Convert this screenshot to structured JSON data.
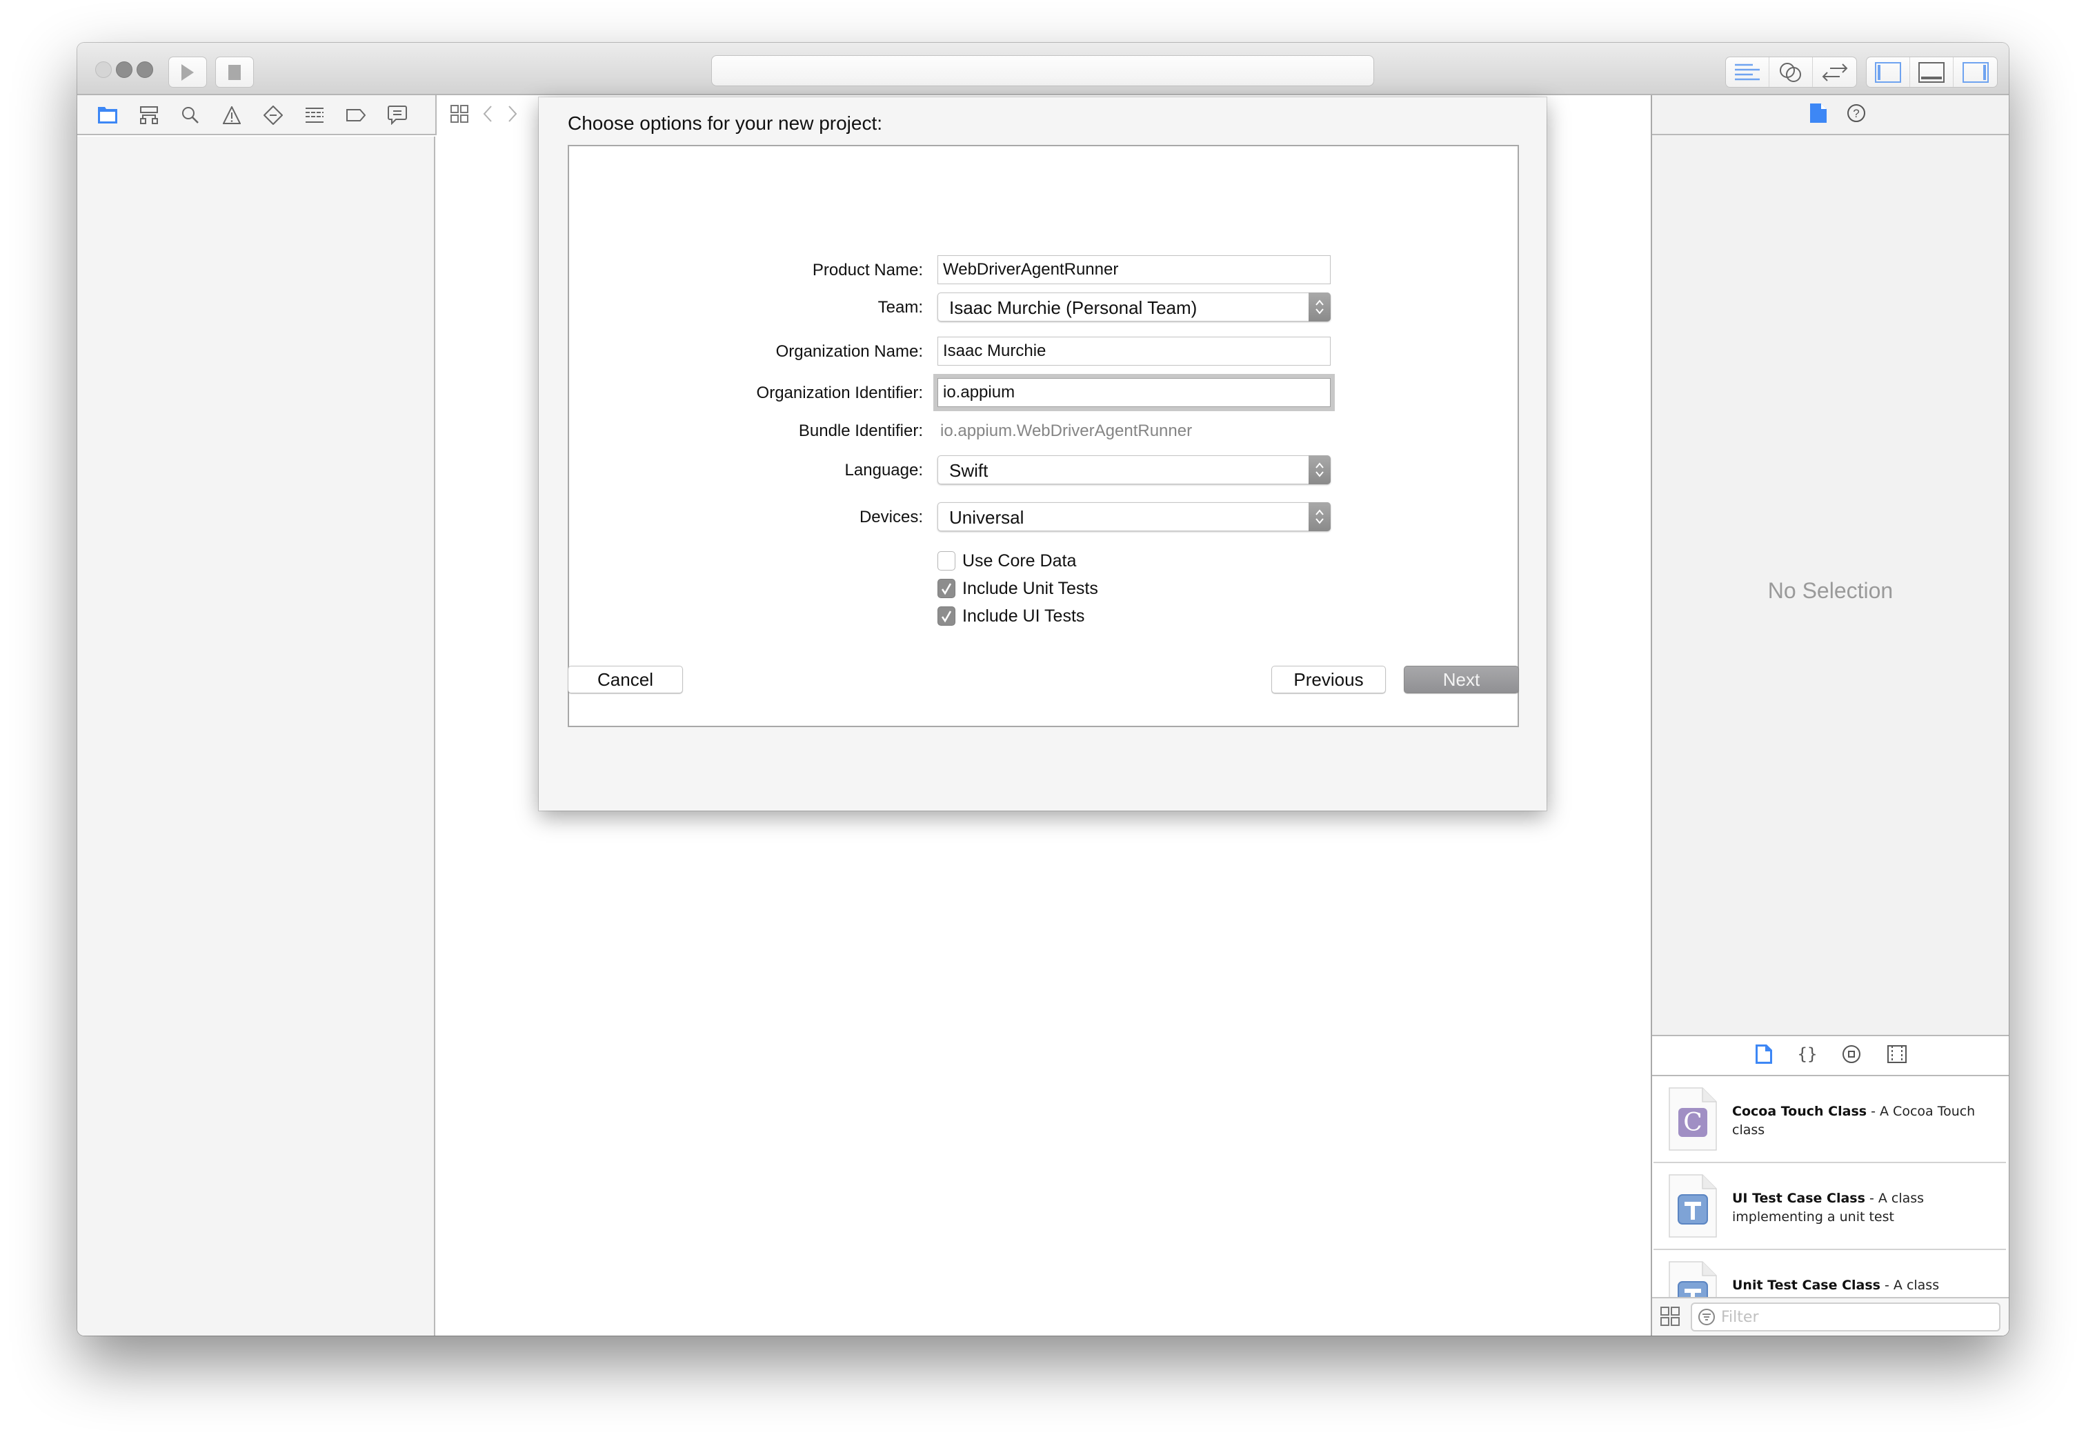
{
  "toolbar": {
    "run_button": "Run",
    "stop_button": "Stop",
    "activity_text": "",
    "editor_modes": [
      "standard-editor-icon",
      "assistant-editor-icon",
      "version-editor-icon"
    ],
    "view_toggles": [
      "navigator-toggle-icon",
      "debug-area-toggle-icon",
      "utilities-toggle-icon"
    ]
  },
  "navigator": {
    "tabs": [
      "project-navigator",
      "symbol-navigator",
      "find-navigator",
      "issue-navigator",
      "test-navigator",
      "debug-navigator",
      "breakpoint-navigator",
      "report-navigator"
    ],
    "active_tab": "project-navigator"
  },
  "inspector": {
    "tabs": [
      "file-inspector",
      "quick-help-inspector"
    ],
    "empty_text": "No Selection"
  },
  "library": {
    "tabs": [
      "file-template-library",
      "code-snippet-library",
      "object-library",
      "media-library"
    ],
    "items": [
      {
        "badge": "C",
        "title": "Cocoa Touch Class",
        "desc": " - A Cocoa Touch class",
        "color": "#a08fc4"
      },
      {
        "badge": "T",
        "title": "UI Test Case Class",
        "desc": " - A class implementing a unit test",
        "color": "#7ea3d6"
      },
      {
        "badge": "T",
        "title": "Unit Test Case Class",
        "desc": " - A class implementing a unit test",
        "color": "#7ea3d6"
      }
    ],
    "filter_placeholder": "Filter",
    "filter_value": ""
  },
  "dialog": {
    "title": "Choose options for your new project:",
    "fields": {
      "product_name": {
        "label": "Product Name:",
        "value": "WebDriverAgentRunner"
      },
      "team": {
        "label": "Team:",
        "value": "Isaac Murchie (Personal Team)"
      },
      "organization_name": {
        "label": "Organization Name:",
        "value": "Isaac Murchie"
      },
      "organization_identifier": {
        "label": "Organization Identifier:",
        "value": "io.appium"
      },
      "bundle_identifier": {
        "label": "Bundle Identifier:",
        "value": "io.appium.WebDriverAgentRunner"
      },
      "language": {
        "label": "Language:",
        "value": "Swift"
      },
      "devices": {
        "label": "Devices:",
        "value": "Universal"
      }
    },
    "checkboxes": [
      {
        "label": "Use Core Data",
        "checked": false
      },
      {
        "label": "Include Unit Tests",
        "checked": true
      },
      {
        "label": "Include UI Tests",
        "checked": true
      }
    ],
    "buttons": {
      "cancel": "Cancel",
      "previous": "Previous",
      "next": "Next"
    }
  },
  "colors": {
    "accent": "#3d87f5",
    "next_button": "#9d9da0"
  }
}
